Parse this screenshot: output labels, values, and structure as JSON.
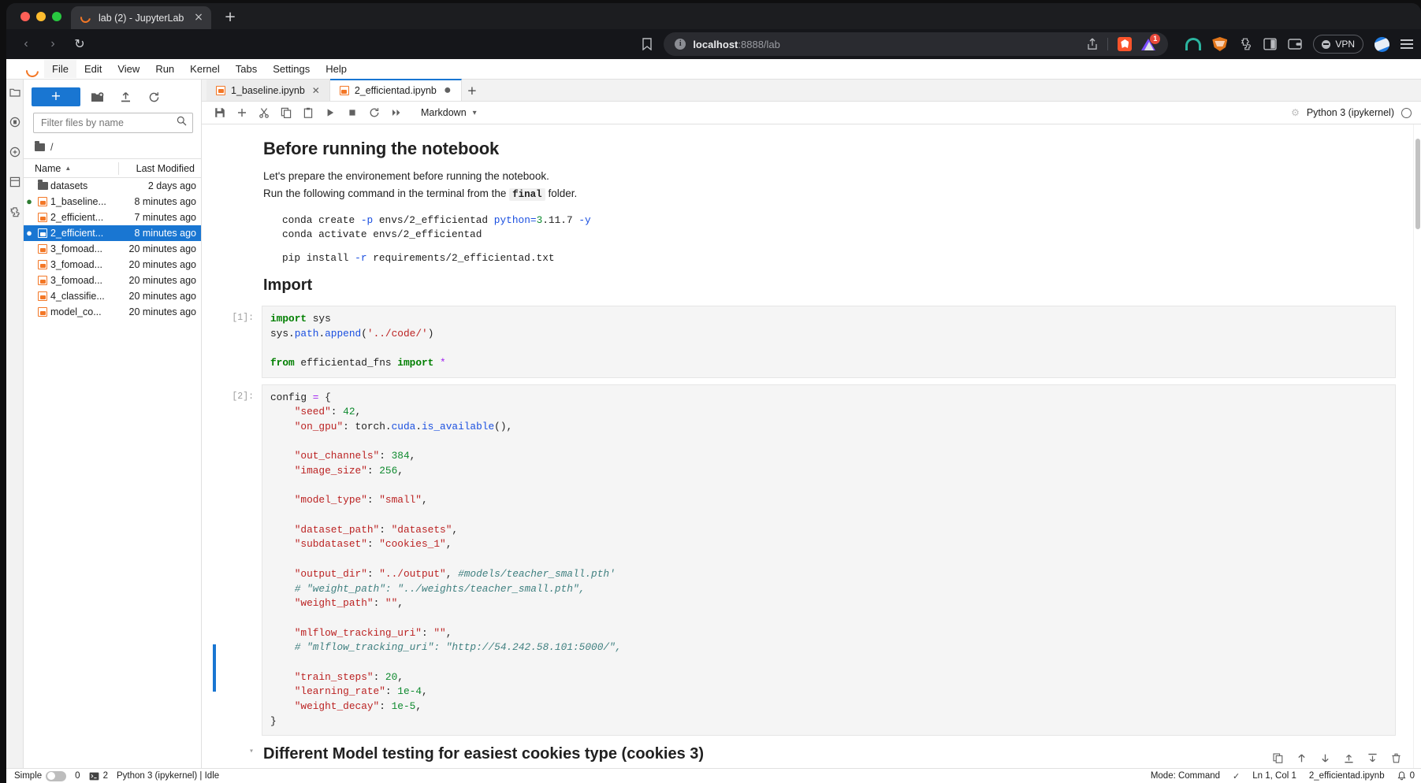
{
  "browser": {
    "tab": {
      "title": "lab (2) - JupyterLab",
      "favicon": "jupyter-favicon",
      "close": "×"
    },
    "new_tab": "+",
    "nav": {
      "back": "‹",
      "forward": "›",
      "reload": "↻"
    },
    "bookmark": "☐",
    "url": {
      "host": "localhost",
      "rest": ":8888/lab",
      "info": "i"
    },
    "share": "⇧",
    "extension_badge": "1",
    "vpn_label": "VPN",
    "menu": "≡"
  },
  "jupyter": {
    "menubar": [
      "File",
      "Edit",
      "View",
      "Run",
      "Kernel",
      "Tabs",
      "Settings",
      "Help"
    ],
    "activitybar": [
      "files-icon",
      "running-icon",
      "commands-icon",
      "property-inspector-icon",
      "extensions-icon"
    ],
    "filebrowser": {
      "new_button": "+",
      "tools": [
        "new-folder-icon",
        "upload-icon",
        "refresh-icon"
      ],
      "filter_placeholder": "Filter files by name",
      "filter_value": "",
      "breadcrumb": "/",
      "columns": {
        "name": "Name",
        "modified": "Last Modified",
        "sort": "▲"
      },
      "rows": [
        {
          "name": "datasets",
          "modified": "2 days ago",
          "type": "folder",
          "selected": false,
          "running": false
        },
        {
          "name": "1_baseline...",
          "modified": "8 minutes ago",
          "type": "notebook",
          "selected": false,
          "running": true
        },
        {
          "name": "2_efficient...",
          "modified": "7 minutes ago",
          "type": "notebook",
          "selected": false,
          "running": false
        },
        {
          "name": "2_efficient...",
          "modified": "8 minutes ago",
          "type": "notebook",
          "selected": true,
          "running": true
        },
        {
          "name": "3_fomoad...",
          "modified": "20 minutes ago",
          "type": "notebook",
          "selected": false,
          "running": false
        },
        {
          "name": "3_fomoad...",
          "modified": "20 minutes ago",
          "type": "notebook",
          "selected": false,
          "running": false
        },
        {
          "name": "3_fomoad...",
          "modified": "20 minutes ago",
          "type": "notebook",
          "selected": false,
          "running": false
        },
        {
          "name": "4_classifie...",
          "modified": "20 minutes ago",
          "type": "notebook",
          "selected": false,
          "running": false
        },
        {
          "name": "model_co...",
          "modified": "20 minutes ago",
          "type": "notebook",
          "selected": false,
          "running": false
        }
      ]
    },
    "tabs": [
      {
        "label": "1_baseline.ipynb",
        "active": false,
        "dirty": false
      },
      {
        "label": "2_efficientad.ipynb",
        "active": true,
        "dirty": true
      }
    ],
    "tab_add": "+",
    "notebook_toolbar": {
      "buttons": [
        "save-icon",
        "insert-cell-icon",
        "cut-icon",
        "copy-icon",
        "paste-icon",
        "run-icon",
        "stop-icon",
        "restart-icon",
        "restart-run-all-icon"
      ],
      "cell_type": "Markdown",
      "cell_type_caret": "∨",
      "kernel_name": "Python 3 (ipykernel)"
    },
    "cells": [
      {
        "type": "markdown",
        "prompt": "",
        "heading": "Before running the notebook",
        "paragraph_1": "Let's prepare the environement before running the notebook.",
        "paragraph_2_a": "Run the following command in the terminal from the",
        "paragraph_2_code": "final",
        "paragraph_2_b": "folder.",
        "pre_1_a": "conda create ",
        "pre_1_flag": "-p",
        "pre_1_b": " envs/2_efficientad ",
        "pre_1_py": "python=",
        "pre_1_ver": "3",
        "pre_1_ver2": ".11.7 ",
        "pre_1_y": "-y",
        "pre_2": "conda activate envs/2_efficientad",
        "pre_3_a": "pip install ",
        "pre_3_flag": "-r",
        "pre_3_b": " requirements/2_efficientad.txt",
        "heading_2": "Import"
      },
      {
        "type": "code",
        "prompt": "[1]:",
        "lines": [
          "import sys",
          "sys.path.append('../code/')",
          "",
          "from efficientad_fns import *"
        ]
      },
      {
        "type": "code",
        "prompt": "[2]:",
        "lines": [
          "config = {",
          "    \"seed\": 42,",
          "    \"on_gpu\": torch.cuda.is_available(),",
          "",
          "    \"out_channels\": 384,",
          "    \"image_size\": 256,",
          "",
          "    \"model_type\": \"small\",",
          "",
          "    \"dataset_path\": \"datasets\",",
          "    \"subdataset\": \"cookies_1\",",
          "",
          "    \"output_dir\": \"../output\", #models/teacher_small.pth'",
          "    # \"weight_path\": \"../weights/teacher_small.pth\",",
          "    \"weight_path\": \"\",",
          "",
          "    \"mlflow_tracking_uri\": \"\",",
          "    # \"mlflow_tracking_uri\": \"http://54.242.58.101:5000/\",",
          "",
          "    \"train_steps\": 20,",
          "    \"learning_rate\": 1e-4,",
          "    \"weight_decay\": 1e-5,",
          "}"
        ]
      },
      {
        "type": "markdown",
        "prompt": "",
        "heading": "Different Model testing for easiest cookies type (cookies 3)"
      }
    ],
    "cell_strip_icons": [
      "duplicate-icon",
      "move-up-icon",
      "move-down-icon",
      "insert-above-icon",
      "insert-below-icon",
      "delete-icon"
    ],
    "statusbar": {
      "mode_label": "Simple",
      "kernel_count": "0",
      "terminal_count": "2",
      "kernel_status": "Python 3 (ipykernel) | Idle",
      "mode": "Mode: Command",
      "position": "Ln 1, Col 1",
      "filename": "2_efficientad.ipynb",
      "notifications": "0"
    }
  },
  "colors": {
    "accent": "#1976d2",
    "jupyter_orange": "#f37726",
    "selected_row": "#1976d2",
    "string": "#bb2222",
    "keyword": "#007f00",
    "number": "#0f8a2f",
    "comment": "#408080"
  }
}
